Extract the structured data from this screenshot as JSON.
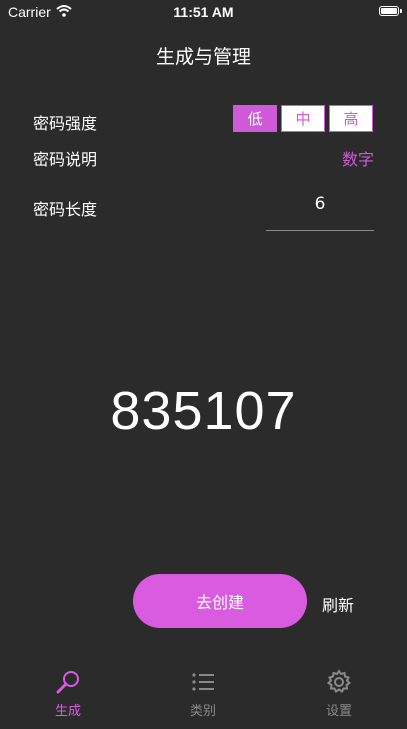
{
  "status_bar": {
    "carrier": "Carrier",
    "time": "11:51 AM"
  },
  "nav": {
    "title": "生成与管理"
  },
  "strength": {
    "label": "密码强度",
    "options": [
      "低",
      "中",
      "高"
    ],
    "selected": "低"
  },
  "description": {
    "label": "密码说明",
    "value": "数字"
  },
  "length": {
    "label": "密码长度",
    "value": "6"
  },
  "password": "835107",
  "actions": {
    "create_label": "去创建",
    "refresh_label": "刷新"
  },
  "tabs": [
    {
      "label": "生成",
      "icon": "magnifier-icon",
      "active": true
    },
    {
      "label": "类别",
      "icon": "list-icon",
      "active": false
    },
    {
      "label": "设置",
      "icon": "gear-icon",
      "active": false
    }
  ],
  "colors": {
    "accent": "#d95be0",
    "background": "#2b2b2b",
    "inactive": "#8a8a8a"
  }
}
